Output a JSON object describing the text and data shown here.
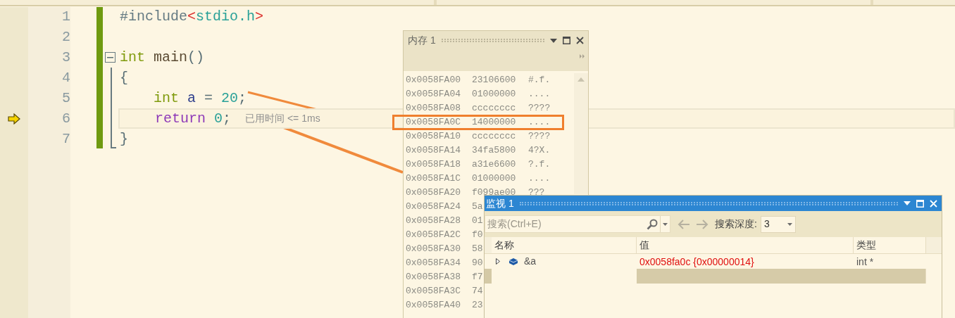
{
  "editor": {
    "lines": [
      {
        "number": "1",
        "current": false,
        "fold": false,
        "indented": false,
        "tokens": [
          {
            "kind": "preprocessor",
            "text": "#include"
          },
          {
            "kind": "bracket",
            "text": "<"
          },
          {
            "kind": "header",
            "text": "stdio.h"
          },
          {
            "kind": "bracket",
            "text": ">"
          }
        ]
      },
      {
        "number": "2",
        "current": false,
        "fold": false
      },
      {
        "number": "3",
        "current": false,
        "fold": true,
        "indented": false,
        "tokens": [
          {
            "kind": "keyword",
            "text": "int"
          },
          {
            "kind": "function",
            "text": " main"
          },
          {
            "kind": "punct",
            "text": "()"
          }
        ]
      },
      {
        "number": "4",
        "current": false,
        "fold": false,
        "indented": false,
        "tokens": [
          {
            "kind": "punct",
            "text": "{"
          }
        ]
      },
      {
        "number": "5",
        "current": false,
        "fold": false,
        "indented": true,
        "tokens": [
          {
            "kind": "keyword",
            "text": "int"
          },
          {
            "kind": "variable",
            "text": " a"
          },
          {
            "kind": "punct",
            "text": " = "
          },
          {
            "kind": "number",
            "text": "20"
          },
          {
            "kind": "punct",
            "text": ";"
          }
        ]
      },
      {
        "number": "6",
        "current": true,
        "fold": false,
        "indented": true,
        "hint": "已用时间 <= 1ms",
        "tokens": [
          {
            "kind": "control",
            "text": "return"
          },
          {
            "kind": "number",
            "text": " 0"
          },
          {
            "kind": "punct",
            "text": ";"
          }
        ]
      },
      {
        "number": "7",
        "current": false,
        "fold": false,
        "indented": false,
        "tokens": [
          {
            "kind": "punct",
            "text": "}"
          }
        ]
      }
    ]
  },
  "memory_window": {
    "title": "内存 1",
    "active": false,
    "rows": [
      {
        "address": "0x0058FA00",
        "hex": "23106600",
        "ascii": "#.f.",
        "marked": false
      },
      {
        "address": "0x0058FA04",
        "hex": "01000000",
        "ascii": "....",
        "marked": false
      },
      {
        "address": "0x0058FA08",
        "hex": "cccccccc",
        "ascii": "????",
        "marked": false
      },
      {
        "address": "0x0058FA0C",
        "hex": "14000000",
        "ascii": "....",
        "marked": true
      },
      {
        "address": "0x0058FA10",
        "hex": "cccccccc",
        "ascii": "????",
        "marked": false
      },
      {
        "address": "0x0058FA14",
        "hex": "34fa5800",
        "ascii": "4?X.",
        "marked": false
      },
      {
        "address": "0x0058FA18",
        "hex": "a31e6600",
        "ascii": "?.f.",
        "marked": false
      },
      {
        "address": "0x0058FA1C",
        "hex": "01000000",
        "ascii": "....",
        "marked": false
      },
      {
        "address": "0x0058FA20",
        "hex": "f099ae00",
        "ascii": "???",
        "marked": false
      },
      {
        "address": "0x0058FA24",
        "hex": "5a",
        "marked": false
      },
      {
        "address": "0x0058FA28",
        "hex": "01",
        "marked": false
      },
      {
        "address": "0x0058FA2C",
        "hex": "f0",
        "marked": false
      },
      {
        "address": "0x0058FA30",
        "hex": "58",
        "marked": false
      },
      {
        "address": "0x0058FA34",
        "hex": "90",
        "marked": false
      },
      {
        "address": "0x0058FA38",
        "hex": "f7",
        "marked": false
      },
      {
        "address": "0x0058FA3C",
        "hex": "74",
        "marked": false
      },
      {
        "address": "0x0058FA40",
        "hex": "23",
        "marked": false
      }
    ]
  },
  "watch_window": {
    "title": "监视 1",
    "active": true,
    "search": {
      "placeholder": "搜索(Ctrl+E)"
    },
    "depth_label": "搜索深度:",
    "depth_value": "3",
    "columns": [
      "名称",
      "值",
      "类型"
    ],
    "rows": [
      {
        "name": "&a",
        "value": "0x0058fa0c {0x00000014}",
        "type": "int *",
        "expanded": false,
        "changed": true
      }
    ]
  }
}
